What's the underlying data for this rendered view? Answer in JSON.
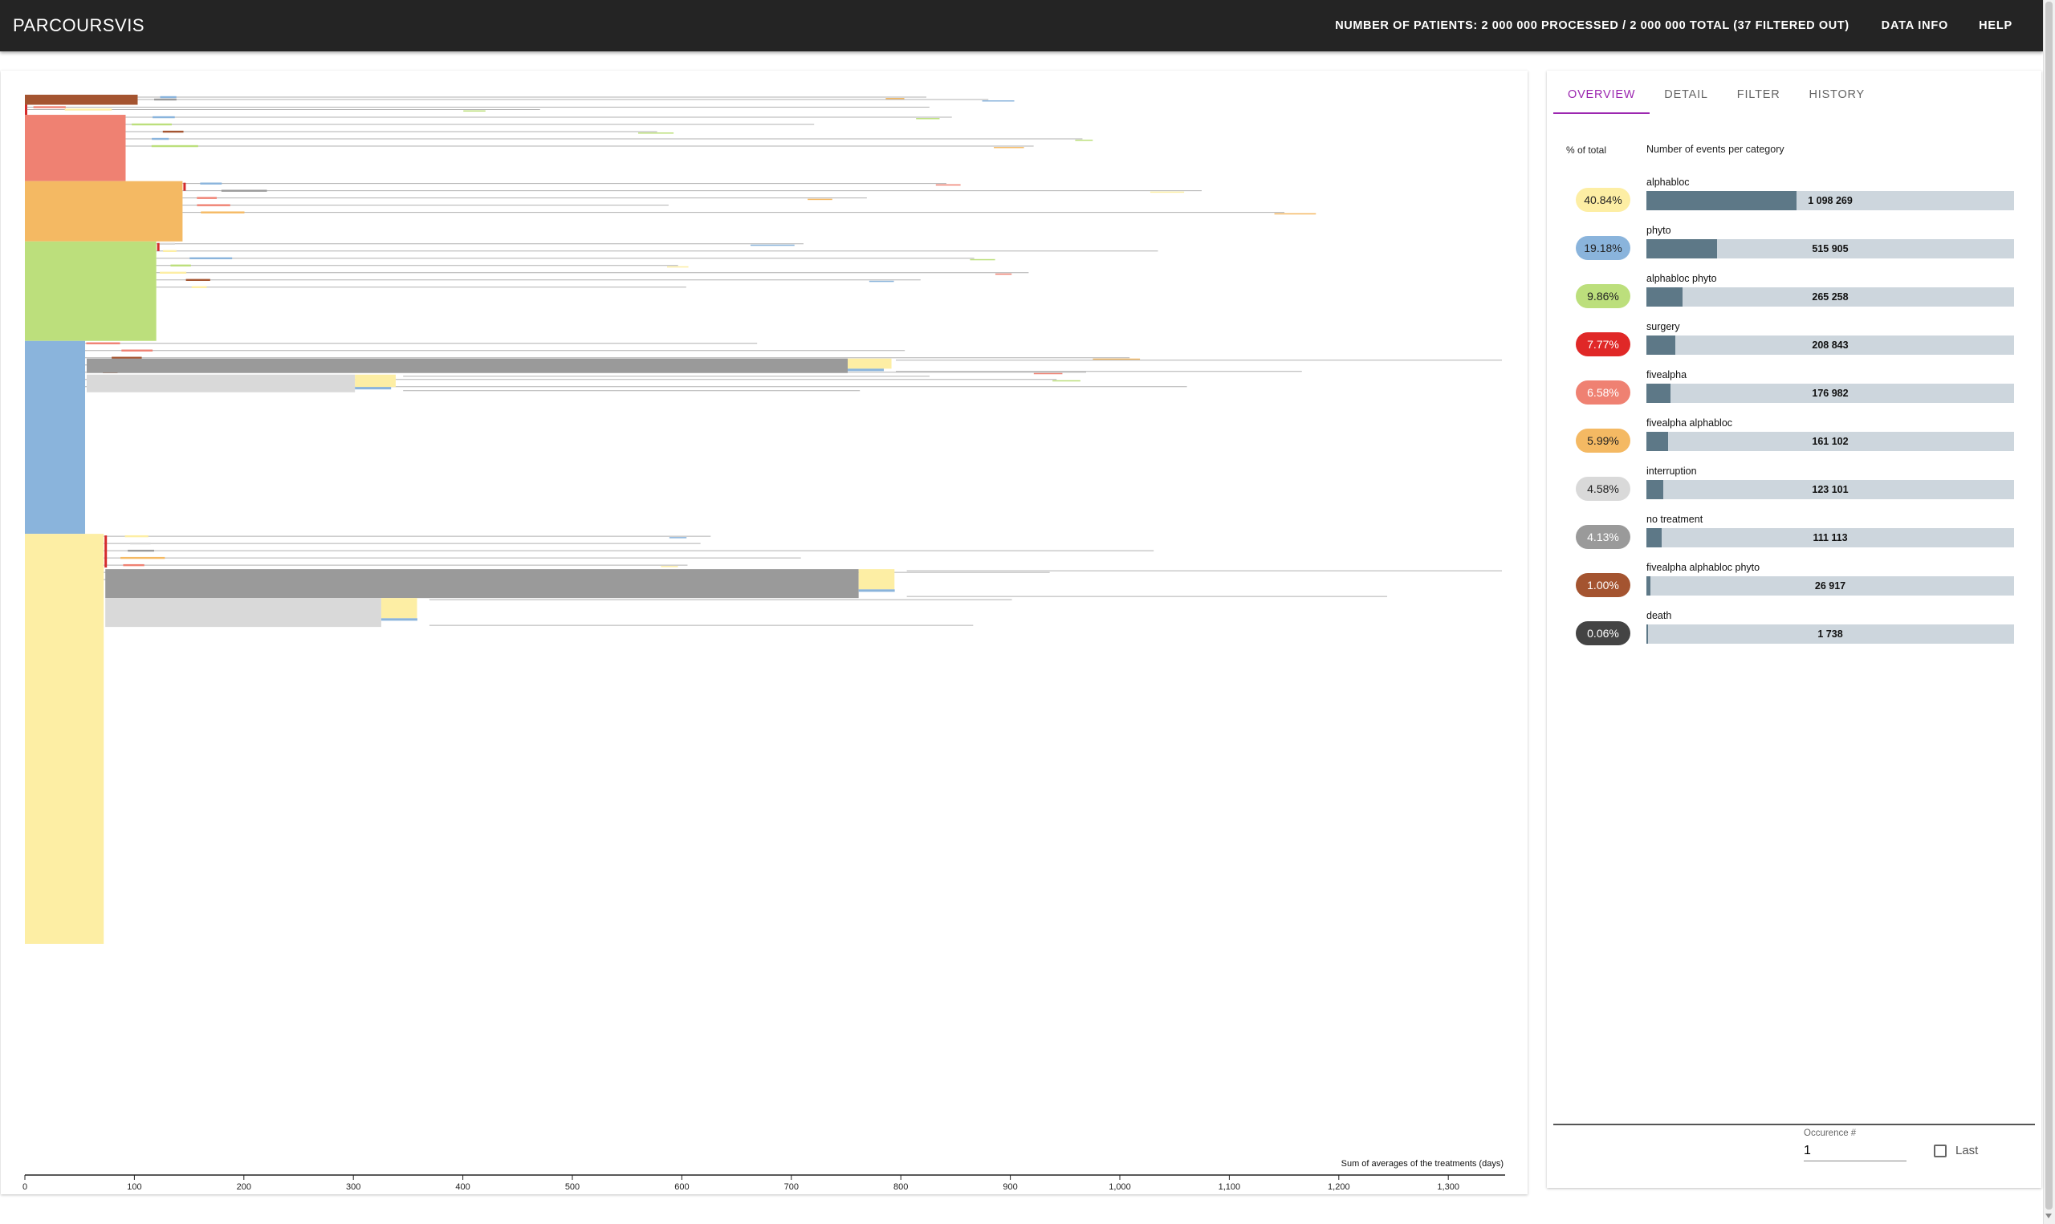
{
  "app": {
    "title": "PARCOURSVIS",
    "stats": "NUMBER OF PATIENTS: 2 000 000 PROCESSED / 2 000 000 TOTAL (37 FILTERED OUT)",
    "nav": [
      "DATA INFO",
      "HELP"
    ]
  },
  "panel": {
    "tabs": [
      {
        "label": "OVERVIEW",
        "active": true
      },
      {
        "label": "DETAIL",
        "active": false
      },
      {
        "label": "FILTER",
        "active": false
      },
      {
        "label": "HISTORY",
        "active": false
      }
    ],
    "pct_header": "% of total",
    "count_header": "Number of events per category",
    "categories": [
      {
        "name": "alphabloc",
        "pct": "40.84%",
        "count": "1 098 269",
        "value": 1098269,
        "color": "#fdeea4",
        "text_color": "#222"
      },
      {
        "name": "phyto",
        "pct": "19.18%",
        "count": "515 905",
        "value": 515905,
        "color": "#8ab4dc",
        "text_color": "#222"
      },
      {
        "name": "alphabloc phyto",
        "pct": "9.86%",
        "count": "265 258",
        "value": 265258,
        "color": "#bcdf7c",
        "text_color": "#222"
      },
      {
        "name": "surgery",
        "pct": "7.77%",
        "count": "208 843",
        "value": 208843,
        "color": "#e02827",
        "text_color": "#fff"
      },
      {
        "name": "fivealpha",
        "pct": "6.58%",
        "count": "176 982",
        "value": 176982,
        "color": "#ef8172",
        "text_color": "#fff"
      },
      {
        "name": "fivealpha alphabloc",
        "pct": "5.99%",
        "count": "161 102",
        "value": 161102,
        "color": "#f4b963",
        "text_color": "#222"
      },
      {
        "name": "interruption",
        "pct": "4.58%",
        "count": "123 101",
        "value": 123101,
        "color": "#d9d9d9",
        "text_color": "#222"
      },
      {
        "name": "no treatment",
        "pct": "4.13%",
        "count": "111 113",
        "value": 111113,
        "color": "#9a9a9a",
        "text_color": "#fff"
      },
      {
        "name": "fivealpha alphabloc phyto",
        "pct": "1.00%",
        "count": "26 917",
        "value": 26917,
        "color": "#a45430",
        "text_color": "#fff"
      },
      {
        "name": "death",
        "pct": "0.06%",
        "count": "1 738",
        "value": 1738,
        "color": "#444444",
        "text_color": "#fff"
      }
    ],
    "occurrence_label": "Occurence #",
    "occurrence_value": "1",
    "last_label": "Last"
  },
  "chart_data": {
    "type": "bar",
    "xlabel": "Sum of averages of the treatments (days)",
    "xlim": [
      0,
      1350
    ],
    "xticks": [
      "0",
      "100",
      "200",
      "300",
      "400",
      "500",
      "600",
      "700",
      "800",
      "900",
      "1,000",
      "1,100",
      "1,200",
      "1,300"
    ],
    "blocks": [
      {
        "category": "fivealpha alphabloc phyto",
        "duration": 103,
        "share": 0.01,
        "color": "#a45430"
      },
      {
        "category": "death",
        "duration": 2,
        "share": 0.01,
        "color": "#d42b2b"
      },
      {
        "category": "fivealpha",
        "duration": 92,
        "share": 0.066,
        "color": "#ef8172"
      },
      {
        "category": "fivealpha alphabloc",
        "duration": 144,
        "share": 0.06,
        "color": "#f4b963"
      },
      {
        "category": "alphabloc phyto",
        "duration": 120,
        "share": 0.099,
        "color": "#bcdf7c"
      },
      {
        "category": "phyto",
        "duration": 55,
        "share": 0.192,
        "color": "#8ab4dc"
      },
      {
        "category": "alphabloc",
        "duration": 72,
        "share": 0.408,
        "color": "#fdeea4"
      }
    ],
    "sub_blocks": [
      {
        "parent": "phyto",
        "category": "no treatment",
        "start": 55,
        "duration": 695,
        "color": "#9a9a9a"
      },
      {
        "parent": "phyto",
        "category": "interruption",
        "start": 55,
        "duration": 245,
        "color": "#d9d9d9"
      },
      {
        "parent": "alphabloc",
        "category": "no treatment",
        "start": 72,
        "duration": 688,
        "color": "#9a9a9a"
      },
      {
        "parent": "alphabloc",
        "category": "interruption",
        "start": 72,
        "duration": 252,
        "color": "#d9d9d9"
      }
    ]
  }
}
